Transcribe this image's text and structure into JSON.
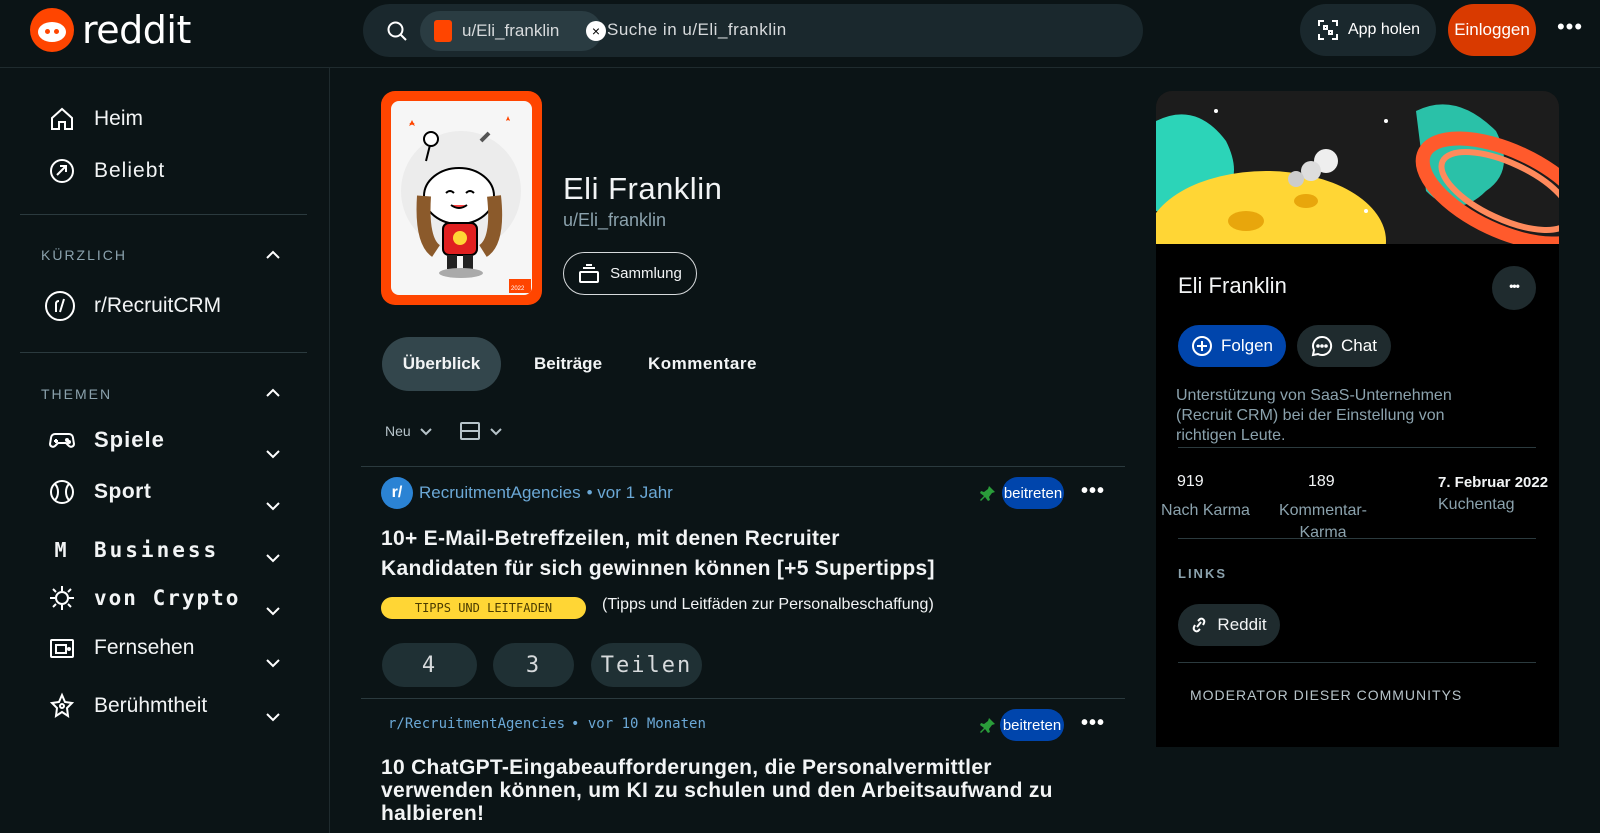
{
  "header": {
    "logo_text": "reddit",
    "search_chip": "u/Eli_franklin",
    "search_placeholder": "Suche in u/Eli_franklin",
    "app_button": "App holen",
    "login_button": "Einloggen",
    "more": "•••"
  },
  "sidebar": {
    "home": "Heim",
    "popular": "Beliebt",
    "recent_title": "KÜRZLICH",
    "recent_item": "r/RecruitCRM",
    "topics_title": "THEMEN",
    "topics": [
      {
        "label": "Spiele",
        "icon": "gamepad-icon"
      },
      {
        "label": "Sport",
        "icon": "ball-icon"
      },
      {
        "label": "Business",
        "icon": "m-letter-icon",
        "prefix": "M"
      },
      {
        "label": "von Crypto",
        "icon": "crypto-icon"
      },
      {
        "label": "Fernsehen",
        "icon": "tv-icon"
      },
      {
        "label": "Berühmtheit",
        "icon": "star-icon"
      }
    ]
  },
  "profile": {
    "name": "Eli Franklin",
    "handle": "u/Eli_franklin",
    "collection_button": "Sammlung",
    "avatar_year": "2022"
  },
  "tabs": {
    "overview": "Überblick",
    "posts": "Beiträge",
    "comments": "Kommentare"
  },
  "sort": {
    "label": "Neu"
  },
  "posts": [
    {
      "subreddit": "RecruitmentAgencies",
      "time": "• vor 1 Jahr",
      "join": "beitreten",
      "title_line1": "10+ E-Mail-Betreffzeilen, mit denen Recruiter",
      "title_line2": "Kandidaten für sich gewinnen können [+5 Supertipps]",
      "flair": "TIPPS UND LEITFADEN",
      "flair_desc": "(Tipps und Leitfäden zur Personalbeschaffung)",
      "votes": "4",
      "comments": "3",
      "share": "Teilen"
    },
    {
      "subreddit": "r/RecruitmentAgencies",
      "time": "• vor 10 Monaten",
      "join": "beitreten",
      "title_line1": "10 ChatGPT-Eingabeaufforderungen, die Personalvermittler",
      "title_line2": "verwenden können, um KI zu schulen und den Arbeitsaufwand zu",
      "title_line3": "halbieren!"
    }
  ],
  "right_card": {
    "name": "Eli Franklin",
    "more": "•••",
    "follow": "Folgen",
    "chat": "Chat",
    "bio_line1": "Unterstützung von SaaS-Unternehmen",
    "bio_line2": "(Recruit CRM) bei der Einstellung von",
    "bio_line3": "richtigen Leute.",
    "post_karma": "919",
    "post_karma_label": "Nach Karma",
    "comment_karma": "189",
    "comment_karma_label_1": "Kommentar-",
    "comment_karma_label_2": "Karma",
    "cake_day": "7. Februar 2022",
    "cake_day_label": "Kuchentag",
    "links_title": "LINKS",
    "reddit_link": "Reddit",
    "mod_title": "MODERATOR DIESER COMMUNITYS"
  },
  "colors": {
    "accent_orange": "#ff4500",
    "join_blue": "#0045ac",
    "background": "#0b1416"
  }
}
